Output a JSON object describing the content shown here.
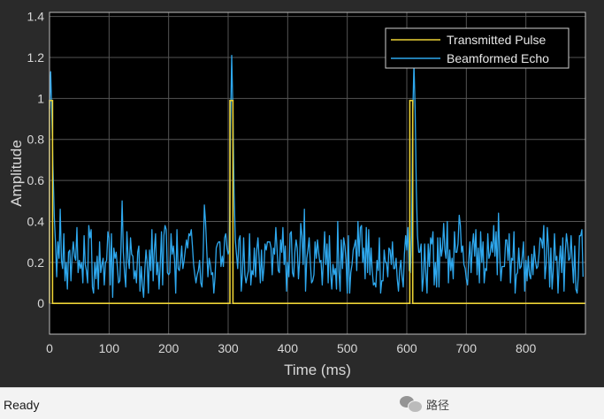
{
  "status": {
    "text": "Ready"
  },
  "watermark": {
    "text": "路径",
    "icon": "wechat-icon"
  },
  "colors": {
    "figure_bg": "#2a2a2a",
    "axes_bg": "#000000",
    "grid": "#555555",
    "tick_text": "#d8d8d8",
    "pulse": "#edd335",
    "echo": "#2ea8ee"
  },
  "chart_data": {
    "type": "line",
    "title": "",
    "xlabel": "Time (ms)",
    "ylabel": "Amplitude",
    "xlim": [
      0,
      900
    ],
    "ylim": [
      -0.15,
      1.42
    ],
    "xticks": [
      0,
      100,
      200,
      300,
      400,
      500,
      600,
      700,
      800
    ],
    "yticks": [
      0,
      0.2,
      0.4,
      0.6,
      0.8,
      1,
      1.2,
      1.4
    ],
    "xtick_labels": [
      "0",
      "100",
      "200",
      "300",
      "400",
      "500",
      "600",
      "700",
      "800"
    ],
    "ytick_labels": [
      "0",
      "0.2",
      "0.4",
      "0.6",
      "0.8",
      "1",
      "1.2",
      "1.4"
    ],
    "grid": true,
    "legend_position": "top-right",
    "series": [
      {
        "name": "Transmitted Pulse",
        "x": [
          0,
          0,
          5,
          5,
          303,
          303,
          308,
          308,
          605,
          605,
          610,
          610,
          900
        ],
        "values": [
          0,
          0.99,
          0.99,
          0,
          0,
          0.99,
          0.99,
          0,
          0,
          0.99,
          0.99,
          0,
          0
        ]
      },
      {
        "name": "Beamformed Echo",
        "x_start": 0,
        "x_step": 2,
        "values": [
          0.95,
          1.13,
          0.9,
          0.65,
          0.42,
          0.3,
          0.13,
          0.3,
          0.22,
          0.46,
          0.21,
          0.17,
          0.34,
          0.11,
          0.2,
          0.07,
          0.25,
          0.26,
          0.11,
          0.24,
          0.3,
          0.23,
          0.21,
          0.37,
          0.15,
          0.21,
          0.17,
          0.2,
          0.1,
          0.33,
          0.19,
          0.16,
          0.1,
          0.38,
          0.32,
          0.36,
          0.08,
          0.05,
          0.2,
          0.12,
          0.23,
          0.07,
          0.3,
          0.15,
          0.19,
          0.22,
          0.09,
          0.2,
          0.21,
          0.35,
          0.32,
          0.09,
          0.34,
          0.03,
          0.27,
          0.22,
          0.25,
          0.17,
          0.1,
          0.11,
          0.27,
          0.5,
          0.25,
          0.15,
          0.08,
          0.35,
          0.22,
          0.17,
          0.32,
          0.24,
          0.23,
          0.12,
          0.16,
          0.1,
          0.25,
          0.28,
          0.06,
          0.18,
          0.09,
          0.03,
          0.16,
          0.26,
          0.2,
          0.05,
          0.26,
          0.16,
          0.36,
          0.11,
          0.26,
          0.34,
          0.14,
          0.2,
          0.07,
          0.19,
          0.35,
          0.09,
          0.33,
          0.38,
          0.36,
          0.15,
          0.14,
          0.15,
          0.34,
          0.24,
          0.28,
          0.21,
          0.05,
          0.36,
          0.17,
          0.16,
          0.2,
          0.28,
          0.17,
          0.21,
          0.26,
          0.31,
          0.27,
          0.34,
          0.33,
          0.36,
          0.28,
          0.19,
          0.14,
          0.1,
          0.14,
          0.16,
          0.21,
          0.1,
          0.08,
          0.23,
          0.48,
          0.4,
          0.26,
          0.13,
          0.22,
          0.19,
          0.14,
          0.15,
          0.05,
          0.13,
          0.27,
          0.29,
          0.3,
          0.3,
          0.18,
          0.23,
          0.18,
          0.32,
          0.34,
          0.27,
          0.24,
          0.26,
          0.86,
          1.21,
          0.93,
          0.54,
          0.31,
          0.24,
          0.17,
          0.31,
          0.33,
          0.06,
          0.15,
          0.32,
          0.14,
          0.1,
          0.13,
          0.16,
          0.34,
          0.09,
          0.16,
          0.14,
          0.27,
          0.13,
          0.26,
          0.32,
          0.22,
          0.1,
          0.26,
          0.11,
          0.17,
          0.29,
          0.26,
          0.3,
          0.3,
          0.3,
          0.27,
          0.14,
          0.27,
          0.24,
          0.37,
          0.27,
          0.16,
          0.15,
          0.31,
          0.25,
          0.37,
          0.19,
          0.28,
          0.06,
          0.2,
          0.13,
          0.34,
          0.35,
          0.15,
          0.13,
          0.25,
          0.31,
          0.27,
          0.12,
          0.21,
          0.39,
          0.33,
          0.19,
          0.46,
          0.06,
          0.22,
          0.26,
          0.32,
          0.2,
          0.1,
          0.11,
          0.14,
          0.3,
          0.22,
          0.31,
          0.25,
          0.2,
          0.21,
          0.09,
          0.21,
          0.35,
          0.19,
          0.29,
          0.1,
          0.33,
          0.15,
          0.07,
          0.19,
          0.14,
          0.17,
          0.07,
          0.4,
          0.16,
          0.06,
          0.31,
          0.17,
          0.32,
          0.28,
          0.21,
          0.05,
          0.33,
          0.05,
          0.15,
          0.19,
          0.26,
          0.28,
          0.31,
          0.16,
          0.4,
          0.23,
          0.37,
          0.38,
          0.2,
          0.27,
          0.12,
          0.37,
          0.15,
          0.36,
          0.14,
          0.27,
          0.16,
          0.09,
          0.1,
          0.08,
          0.21,
          0.16,
          0.32,
          0.05,
          0.11,
          0.11,
          0.26,
          0.2,
          0.2,
          0.13,
          0.27,
          0.26,
          0.19,
          0.3,
          0.17,
          0.17,
          0.22,
          0.12,
          0.06,
          0.16,
          0.21,
          0.13,
          0.08,
          0.24,
          0.33,
          0.26,
          0.37,
          0.16,
          0.15,
          0.33,
          0.91,
          1.17,
          0.95,
          0.55,
          0.33,
          0.25,
          0.25,
          0.29,
          0.06,
          0.13,
          0.29,
          0.15,
          0.05,
          0.29,
          0.18,
          0.32,
          0.29,
          0.35,
          0.09,
          0.2,
          0.08,
          0.32,
          0.08,
          0.32,
          0.23,
          0.27,
          0.39,
          0.26,
          0.22,
          0.4,
          0.1,
          0.26,
          0.16,
          0.22,
          0.12,
          0.35,
          0.25,
          0.25,
          0.29,
          0.43,
          0.38,
          0.25,
          0.28,
          0.19,
          0.17,
          0.12,
          0.09,
          0.21,
          0.3,
          0.15,
          0.28,
          0.34,
          0.23,
          0.36,
          0.14,
          0.27,
          0.1,
          0.35,
          0.2,
          0.3,
          0.1,
          0.17,
          0.16,
          0.34,
          0.22,
          0.24,
          0.3,
          0.25,
          0.38,
          0.23,
          0.35,
          0.14,
          0.44,
          0.25,
          0.11,
          0.18,
          0.18,
          0.18,
          0.31,
          0.31,
          0.21,
          0.34,
          0.1,
          0.22,
          0.21,
          0.35,
          0.05,
          0.14,
          0.15,
          0.27,
          0.17,
          0.18,
          0.23,
          0.3,
          0.06,
          0.21,
          0.11,
          0.23,
          0.14,
          0.12,
          0.24,
          0.14,
          0.28,
          0.21,
          0.17,
          0.18,
          0.24,
          0.32,
          0.31,
          0.27,
          0.38,
          0.12,
          0.19,
          0.37,
          0.27,
          0.08,
          0.27,
          0.07,
          0.16,
          0.34,
          0.21,
          0.23,
          0.05,
          0.2,
          0.28,
          0.15,
          0.32,
          0.06,
          0.24,
          0.34,
          0.29,
          0.21,
          0.22,
          0.33,
          0.2,
          0.1,
          0.28,
          0.07,
          0.05,
          0.13,
          0.33,
          0.33,
          0.36,
          0.13
        ]
      }
    ]
  }
}
